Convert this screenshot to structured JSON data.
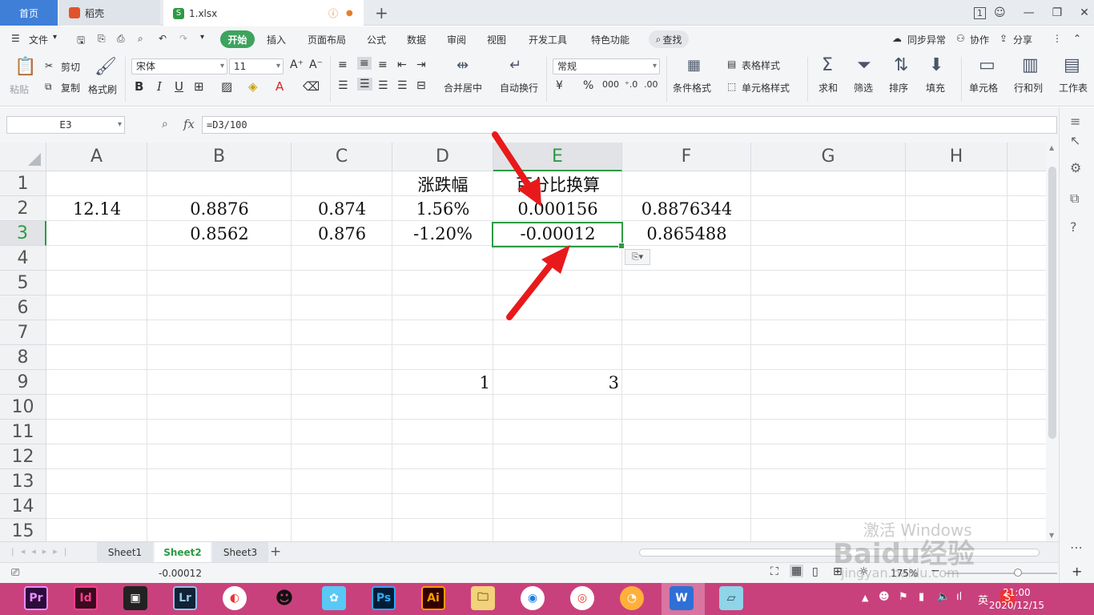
{
  "tabs": {
    "home": "首页",
    "docer": "稻壳",
    "file": "1.xlsx"
  },
  "window": {
    "badge": "1"
  },
  "menu": {
    "file": "文件",
    "items": [
      "开始",
      "插入",
      "页面布局",
      "公式",
      "数据",
      "审阅",
      "视图",
      "开发工具",
      "特色功能"
    ],
    "search": "查找",
    "sync": "同步异常",
    "collab": "协作",
    "share": "分享"
  },
  "ribbon": {
    "paste": "粘贴",
    "cut": "剪切",
    "copy": "复制",
    "format_painter": "格式刷",
    "font": "宋体",
    "size": "11",
    "merge": "合并居中",
    "wrap": "自动换行",
    "number_format": "常规",
    "cond_format": "条件格式",
    "table_style": "表格样式",
    "cell_style": "单元格样式",
    "sum": "求和",
    "filter": "筛选",
    "sort": "排序",
    "fill": "填充",
    "cell": "单元格",
    "rowcol": "行和列",
    "sheet": "工作表"
  },
  "formula": {
    "namebox": "E3",
    "fx": "fx",
    "value": "=D3/100"
  },
  "grid": {
    "columns": [
      "A",
      "B",
      "C",
      "D",
      "E",
      "F",
      "G",
      "H"
    ],
    "rows": [
      "1",
      "2",
      "3",
      "4",
      "5",
      "6",
      "7",
      "8",
      "9",
      "10",
      "11",
      "12",
      "13",
      "14",
      "15"
    ],
    "cells": {
      "D1": "涨跌幅",
      "E1": "百分比换算",
      "A2": "12.14",
      "B2": "0.8876",
      "C2": "0.874",
      "D2": "1.56%",
      "E2": "0.000156",
      "F2": "0.8876344",
      "B3": "0.8562",
      "C3": "0.876",
      "D3": "-1.20%",
      "E3": "-0.00012",
      "F3": "0.865488",
      "D9": "1",
      "E9": "3"
    },
    "selected": "E3"
  },
  "sheets": [
    "Sheet1",
    "Sheet2",
    "Sheet3"
  ],
  "active_sheet": "Sheet2",
  "status": {
    "value": "-0.00012",
    "zoom": "175%"
  },
  "taskbar": {
    "apps": [
      "Pr",
      "Id",
      "Lr",
      "Ps",
      "Ai"
    ],
    "ime": "英",
    "time": "21:00",
    "date": "2020/12/15"
  },
  "watermark": {
    "activate": "激活 Windows",
    "site": "jingyan.baidu.com",
    "brand": "Baidu经验"
  },
  "colors": {
    "accent_green": "#2e9a45",
    "tab_blue": "#3f7fd8",
    "taskbar": "#c9417c",
    "arrow_red": "#e8191b"
  }
}
